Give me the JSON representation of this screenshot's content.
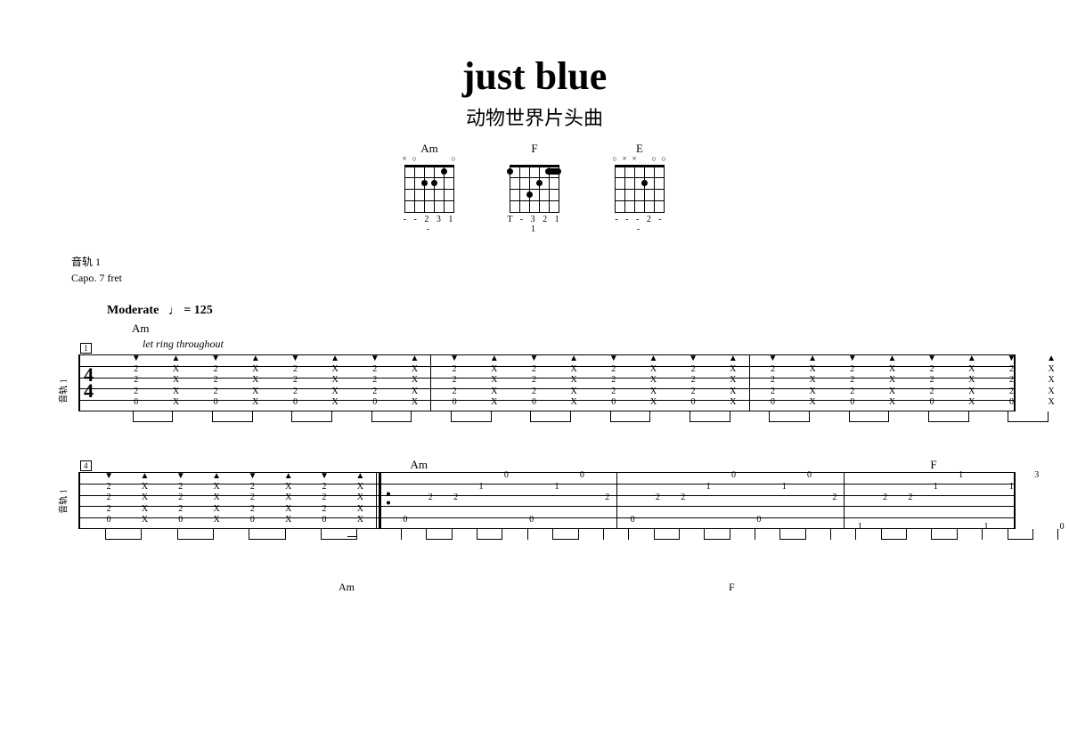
{
  "title": "just blue",
  "subtitle": "动物世界片头曲",
  "chord_diagrams": [
    {
      "name": "Am",
      "markers": "× ○    ○",
      "fingering": "- - 2 3 1 -",
      "dots": [
        {
          "s": 3,
          "f": 2
        },
        {
          "s": 4,
          "f": 2
        },
        {
          "s": 2,
          "f": 1
        }
      ]
    },
    {
      "name": "F",
      "markers": "        ",
      "fingering": "T - 3 2 1 1",
      "dots": [
        {
          "s": 6,
          "f": 1
        },
        {
          "s": 3,
          "f": 2
        },
        {
          "s": 4,
          "f": 3
        }
      ],
      "barre": {
        "from": 1,
        "to": 2,
        "f": 1
      }
    },
    {
      "name": "E",
      "markers": "○×× ○ ○",
      "fingering": "- - - 2 - -",
      "dots": [
        {
          "s": 4,
          "f": 2
        }
      ]
    }
  ],
  "track_label": "音轨 1",
  "capo": "Capo. 7 fret",
  "tempo_style": "Moderate",
  "tempo_bpm": "= 125",
  "chord_over_intro": "Am",
  "instruction": "let ring throughout",
  "system1": {
    "meas_num": "1",
    "ts_top": "4",
    "ts_bot": "4",
    "notes": {
      "d": "2\n2\n2\n0",
      "x": "X\nX\nX\nX"
    }
  },
  "system2": {
    "meas_num": "4",
    "chord_labels": [
      {
        "text": "Am",
        "x": 33.5
      },
      {
        "text": "F",
        "x": 86
      }
    ],
    "intro_notes": {
      "d": "2\n2\n2\n0",
      "x": "X\nX\nX\nX"
    },
    "m5": {
      "n": [
        {
          "s": 5,
          "v": "0"
        },
        {
          "s": 3,
          "v": "2"
        },
        {
          "s": 3,
          "v": "2"
        },
        {
          "s": 2,
          "v": "1"
        },
        {
          "s": 1,
          "v": "0"
        },
        {
          "s": 5,
          "v": "0"
        },
        {
          "s": 2,
          "v": "1"
        },
        {
          "s": 1,
          "v": "0"
        },
        {
          "s": 3,
          "v": "2"
        }
      ]
    },
    "m6": {
      "n": [
        {
          "s": 5,
          "v": "0"
        },
        {
          "s": 3,
          "v": "2"
        },
        {
          "s": 3,
          "v": "2"
        },
        {
          "s": 2,
          "v": "1"
        },
        {
          "s": 1,
          "v": "0"
        },
        {
          "s": 5,
          "v": "0"
        },
        {
          "s": 2,
          "v": "1"
        },
        {
          "s": 1,
          "v": "0"
        },
        {
          "s": 3,
          "v": "2"
        }
      ]
    },
    "m7": {
      "n": [
        {
          "s": 6,
          "v": "1"
        },
        {
          "s": 3,
          "v": "2"
        },
        {
          "s": 3,
          "v": "2"
        },
        {
          "s": 2,
          "v": "1"
        },
        {
          "s": 1,
          "v": "1"
        },
        {
          "s": 6,
          "v": "1"
        },
        {
          "s": 2,
          "v": "1"
        },
        {
          "s": 1,
          "v": "3"
        },
        {
          "s": 6,
          "v": "0"
        }
      ]
    }
  },
  "staff_label": "音轨 1",
  "bottom_preview": {
    "left": "Am",
    "right": "F"
  }
}
